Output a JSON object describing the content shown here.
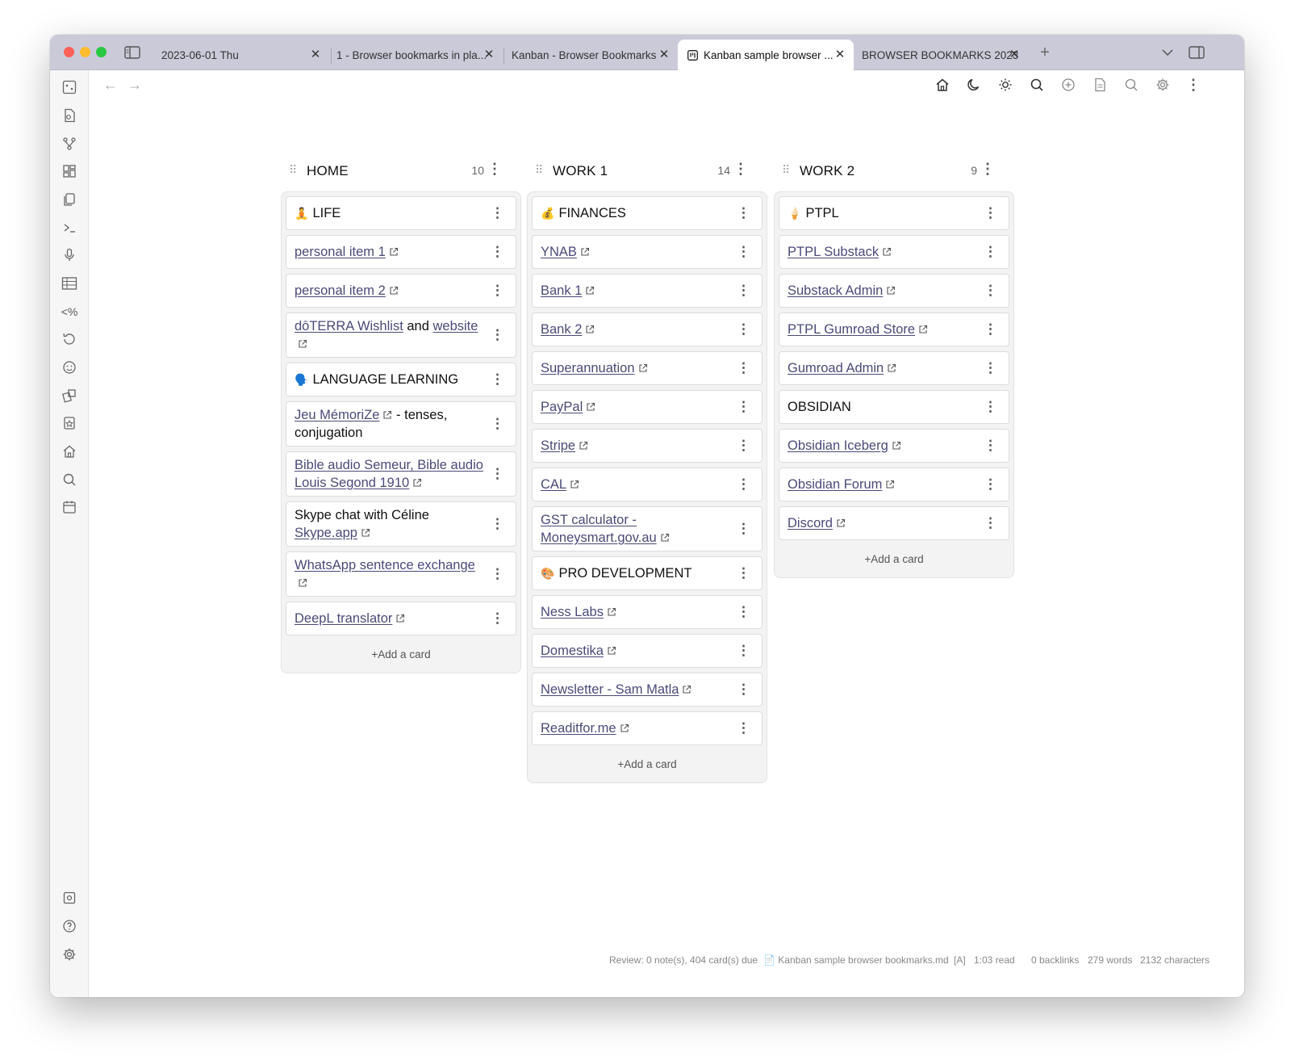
{
  "tabs": [
    {
      "title": "2023-06-01 Thu"
    },
    {
      "title": "1 - Browser bookmarks in pla..."
    },
    {
      "title": "Kanban - Browser Bookmarks"
    },
    {
      "title": "Kanban sample browser ..."
    },
    {
      "title": "BROWSER BOOKMARKS 2023"
    }
  ],
  "board": {
    "lanes": [
      {
        "title": "HOME",
        "count": "10",
        "add_label": "+Add a card",
        "cards": [
          {
            "emoji": "🧘",
            "text": "LIFE"
          },
          {
            "link": "personal item 1"
          },
          {
            "link": "personal item 2"
          },
          {
            "link": "dōTERRA Wishlist",
            "after": " and ",
            "link2": "website"
          },
          {
            "emoji": "🗣️",
            "text": "LANGUAGE LEARNING"
          },
          {
            "link": "Jeu MémoriZe",
            "after": " - tenses, conjugation"
          },
          {
            "link": "Bible audio Semeur, Bible audio Louis Segond 1910"
          },
          {
            "text": "Skype chat with Céline",
            "link2": "Skype.app"
          },
          {
            "link": "WhatsApp sentence exchange"
          },
          {
            "link": "DeepL translator"
          }
        ]
      },
      {
        "title": "WORK 1",
        "count": "14",
        "add_label": "+Add a card",
        "cards": [
          {
            "emoji": "💰",
            "text": "FINANCES"
          },
          {
            "link": "YNAB"
          },
          {
            "link": "Bank 1"
          },
          {
            "link": "Bank 2"
          },
          {
            "link": "Superannuation"
          },
          {
            "link": "PayPal"
          },
          {
            "link": "Stripe"
          },
          {
            "link": "CAL"
          },
          {
            "link": "GST calculator - Moneysmart.gov.au"
          },
          {
            "emoji": "🎨",
            "text": "PRO DEVELOPMENT"
          },
          {
            "link": "Ness Labs"
          },
          {
            "link": "Domestika"
          },
          {
            "link": "Newsletter - Sam Matla"
          },
          {
            "link": "Readitfor.me"
          }
        ]
      },
      {
        "title": "WORK 2",
        "count": "9",
        "add_label": "+Add a card",
        "cards": [
          {
            "emoji": "🍦",
            "text": "PTPL"
          },
          {
            "link": "PTPL Substack"
          },
          {
            "link": "Substack Admin"
          },
          {
            "link": "PTPL Gumroad Store"
          },
          {
            "link": "Gumroad Admin"
          },
          {
            "text": "OBSIDIAN"
          },
          {
            "link": "Obsidian Iceberg"
          },
          {
            "link": "Obsidian Forum"
          },
          {
            "link": "Discord"
          }
        ]
      }
    ]
  },
  "status": {
    "review": "Review: 0 note(s), 404 card(s) due",
    "file": "Kanban sample browser bookmarks.md",
    "mode": "[A]",
    "read_time": "1:03 read",
    "backlinks": "0 backlinks",
    "words": "279 words",
    "characters": "2132 characters"
  }
}
